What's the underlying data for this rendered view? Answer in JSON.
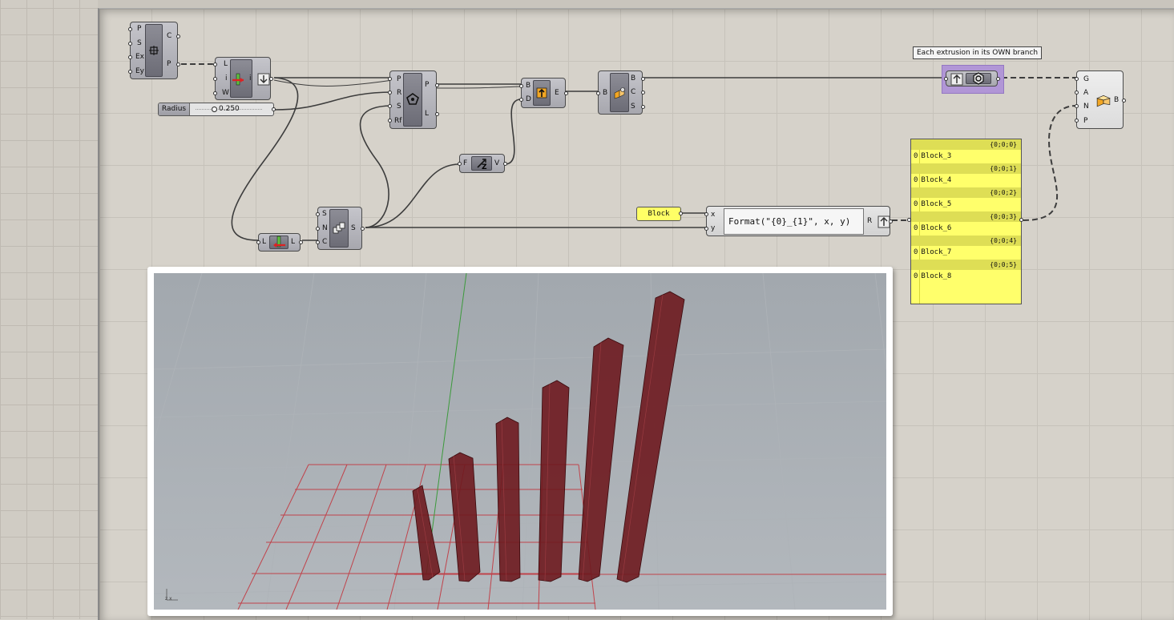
{
  "canvas": {
    "pt_component": {
      "inputs": [
        "P",
        "S",
        "Ex",
        "Ey"
      ],
      "outputs": [
        "C",
        "P"
      ]
    },
    "list_item": {
      "inputs": [
        "L",
        "i",
        "W"
      ],
      "output": "i"
    },
    "slider": {
      "name": "Radius",
      "value": "0.250"
    },
    "polygon": {
      "inputs": [
        "P",
        "R",
        "S",
        "Rf"
      ],
      "outputs": [
        "P",
        "L"
      ]
    },
    "extrude": {
      "inputs": [
        "B",
        "D"
      ],
      "output": "E"
    },
    "brep_join": {
      "input": "B",
      "outputs": [
        "B",
        "C",
        "S"
      ]
    },
    "unit_z": {
      "input": "F",
      "output": "V"
    },
    "series": {
      "inputs": [
        "S",
        "N",
        "C"
      ],
      "output": "S"
    },
    "list_length": {
      "input": "L",
      "output": "L"
    },
    "graft": {
      "tooltip": "Each extrusion in its OWN branch"
    },
    "bake": {
      "inputs": [
        "G",
        "A",
        "N",
        "P"
      ],
      "output": "B"
    },
    "text_panel": {
      "value": "Block"
    },
    "expression": {
      "inputs": [
        "x",
        "y"
      ],
      "output": "R",
      "formula": "Format(\"{0}_{1}\", x, y)"
    },
    "output_panel": {
      "branches": [
        {
          "path": "{0;0;0}",
          "index": "0",
          "value": "Block_3"
        },
        {
          "path": "{0;0;1}",
          "index": "0",
          "value": "Block_4"
        },
        {
          "path": "{0;0;2}",
          "index": "0",
          "value": "Block_5"
        },
        {
          "path": "{0;0;3}",
          "index": "0",
          "value": "Block_6"
        },
        {
          "path": "{0;0;4}",
          "index": "0",
          "value": "Block_7"
        },
        {
          "path": "{0;0;5}",
          "index": "0",
          "value": "Block_8"
        }
      ]
    }
  },
  "viewport": {
    "axis_label": "z x",
    "column_color": "#6e1a1f",
    "grid_color": "#c0434b"
  },
  "colors": {
    "canvas_bg": "#d6d2ca",
    "panel_yellow": "#ffff6b",
    "graft_highlight": "#b196d6"
  }
}
